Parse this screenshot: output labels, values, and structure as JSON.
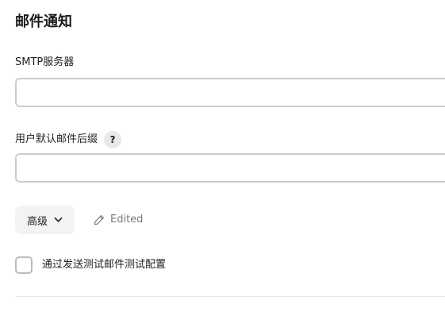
{
  "section": {
    "title": "邮件通知"
  },
  "smtp_server": {
    "label": "SMTP服务器",
    "value": "",
    "placeholder": ""
  },
  "default_suffix": {
    "label": "用户默认邮件后缀",
    "help_label": "?",
    "value": "",
    "placeholder": ""
  },
  "advanced": {
    "label": "高级",
    "icon": "chevron-down-icon"
  },
  "edited": {
    "label": "Edited",
    "icon": "pencil-icon"
  },
  "test_config": {
    "label": "通过发送测试邮件测试配置",
    "checked": false
  },
  "colors": {
    "input_border": "#c9cdd0",
    "help_badge_bg": "#e9e9ea",
    "advanced_button_bg": "#f2f3f4",
    "muted_text": "#75787d"
  }
}
